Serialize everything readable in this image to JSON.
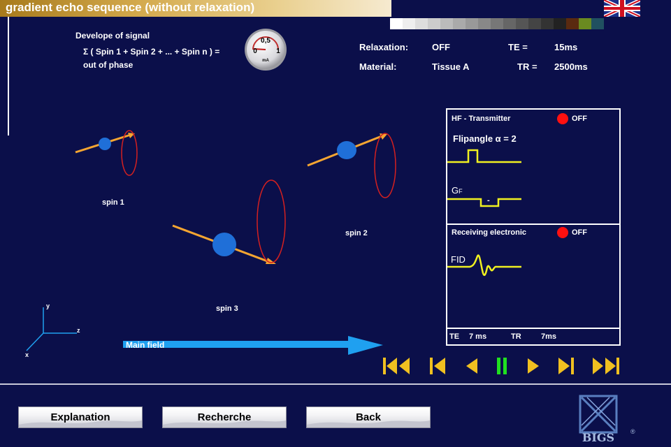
{
  "window": {
    "title": "gradient echo sequence (without relaxation)",
    "language_flag": "uk-flag-icon"
  },
  "colors": {
    "background": "#0b0f4a",
    "title_gold": "#c79a3a",
    "spin_blue": "#1f6fd8",
    "vector_orange": "#f5a531",
    "precession_red": "#d42020",
    "signal_yellow": "#f0f020",
    "main_field_blue": "#1fa0f0",
    "transport_yellow": "#f0c020",
    "pause_green": "#20e020",
    "led_red": "#ff1010"
  },
  "grayscale_bar": [
    "#ffffff",
    "#eeeeee",
    "#dddddd",
    "#cccccc",
    "#bbbbbb",
    "#aaaaaa",
    "#999999",
    "#888888",
    "#777777",
    "#666666",
    "#555555",
    "#444444",
    "#333333",
    "#222222",
    "#5a2a10",
    "#6a8a20",
    "#205060"
  ],
  "signal": {
    "heading": "Develope of signal",
    "formula": "Σ ( Spin 1 + Spin 2 + ... + Spin n ) =",
    "state": "out of phase"
  },
  "gauge": {
    "max_label": "0,5",
    "min_label": "0",
    "right_label": "1",
    "unit": "mA",
    "needle_value": 0.0
  },
  "parameters": {
    "relaxation_label": "Relaxation:",
    "relaxation_value": "OFF",
    "material_label": "Material:",
    "material_value": "Tissue A",
    "te_label": "TE =",
    "te_value": "15ms",
    "tr_label": "TR =",
    "tr_value": "2500ms"
  },
  "spins": [
    {
      "label": "spin 1"
    },
    {
      "label": "spin 2"
    },
    {
      "label": "spin 3"
    }
  ],
  "axes": {
    "x": "x",
    "y": "y",
    "z": "z"
  },
  "main_field": {
    "label": "Main field"
  },
  "panel": {
    "hf_title": "HF - Transmitter",
    "hf_status": "OFF",
    "flipangle": "Flipangle α = 2",
    "gf_label": "G",
    "gf_sub": "F",
    "gf_minus": "-",
    "rx_title": "Receiving electronic",
    "rx_status": "OFF",
    "fid_label": "FID",
    "te_label": "TE",
    "te_value": "7 ms",
    "tr_label": "TR",
    "tr_value": "7ms"
  },
  "transport": [
    {
      "name": "rewind-to-start-button",
      "icon": "skip-to-start-icon"
    },
    {
      "name": "step-back-button",
      "icon": "step-back-icon"
    },
    {
      "name": "play-reverse-button",
      "icon": "play-reverse-icon"
    },
    {
      "name": "pause-button",
      "icon": "pause-icon"
    },
    {
      "name": "play-button",
      "icon": "play-icon"
    },
    {
      "name": "step-forward-button",
      "icon": "step-forward-icon"
    },
    {
      "name": "forward-to-end-button",
      "icon": "skip-to-end-icon"
    }
  ],
  "nav": {
    "explanation": "Explanation",
    "recherche": "Recherche",
    "back": "Back"
  },
  "logo": {
    "text": "BIGS",
    "mark": "®"
  }
}
